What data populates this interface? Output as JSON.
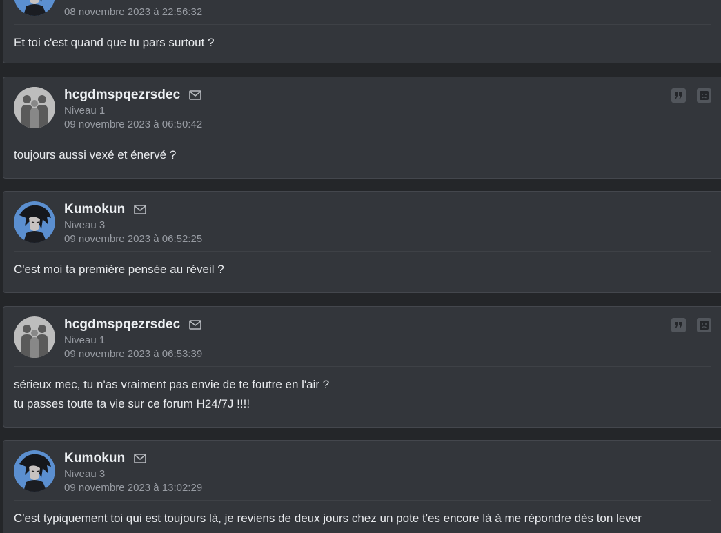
{
  "posts": [
    {
      "author": "",
      "level": "",
      "date": "08 novembre 2023 à 22:56:32",
      "lines": [
        "Et toi c'est quand que tu pars surtout ?"
      ],
      "avatar": "kumokun-avatar",
      "actions": false
    },
    {
      "author": "hcgdmspqezrsdec",
      "level": "Niveau 1",
      "date": "09 novembre 2023 à 06:50:42",
      "lines": [
        "toujours aussi vexé et énervé ?"
      ],
      "avatar": "default-silhouettes-avatar",
      "actions": true
    },
    {
      "author": "Kumokun",
      "level": "Niveau 3",
      "date": "09 novembre 2023 à 06:52:25",
      "lines": [
        "C'est moi ta première pensée au réveil ?"
      ],
      "avatar": "kumokun-avatar",
      "actions": false
    },
    {
      "author": "hcgdmspqezrsdec",
      "level": "Niveau 1",
      "date": "09 novembre 2023 à 06:53:39",
      "lines": [
        "sérieux mec, tu n'as vraiment pas envie de te foutre en l'air ?",
        "tu passes toute ta vie sur ce forum H24/7J !!!!"
      ],
      "avatar": "default-silhouettes-avatar",
      "actions": true
    },
    {
      "author": "Kumokun",
      "level": "Niveau 3",
      "date": "09 novembre 2023 à 13:02:29",
      "lines": [
        "C'est typiquement toi qui est toujours là, je reviens de deux jours chez un pote t'es encore là à me répondre dès ton lever"
      ],
      "avatar": "kumokun-avatar",
      "actions": false
    }
  ],
  "icons": {
    "mail": "envelope-icon",
    "quote": "quote-icon",
    "report": "sad-face-icon"
  },
  "colors": {
    "background": "#242629",
    "card": "#33363b",
    "text": "#e8eaed",
    "muted": "#979ba2"
  }
}
